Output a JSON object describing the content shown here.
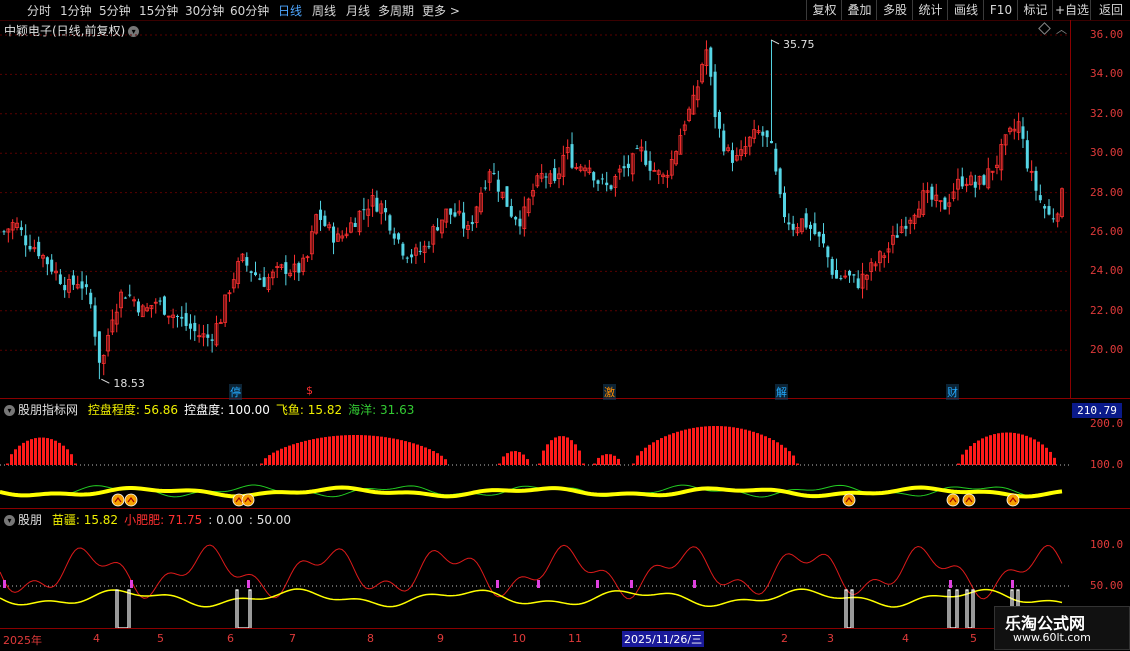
{
  "toolbar": {
    "left": [
      {
        "label": "分时",
        "active": false
      },
      {
        "label": "1分钟",
        "active": false
      },
      {
        "label": "5分钟",
        "active": false
      },
      {
        "label": "15分钟",
        "active": false
      },
      {
        "label": "30分钟",
        "active": false
      },
      {
        "label": "60分钟",
        "active": false
      },
      {
        "label": "日线",
        "active": true
      },
      {
        "label": "周线",
        "active": false
      },
      {
        "label": "月线",
        "active": false
      },
      {
        "label": "多周期",
        "active": false
      },
      {
        "label": "更多 >",
        "active": false
      }
    ],
    "right": [
      "复权",
      "叠加",
      "多股",
      "统计",
      "画线",
      "F10",
      "标记",
      "+自选",
      "返回"
    ]
  },
  "main_chart": {
    "title": "中颖电子(日线,前复权)",
    "high_label": "35.75",
    "low_label": "18.53",
    "events": [
      {
        "label": "停",
        "color": "#22aaff"
      },
      {
        "label": "$",
        "color": "#ff3030"
      },
      {
        "label": "激",
        "color": "#ff8c00"
      },
      {
        "label": "解",
        "color": "#22aaff"
      },
      {
        "label": "财",
        "color": "#22aaff"
      }
    ]
  },
  "indicator1": {
    "name": "股朋指标网",
    "items": [
      {
        "label": "控盘程度: 56.86",
        "color": "#f0f000"
      },
      {
        "label": "控盘度: 100.00",
        "color": "#ffffff"
      },
      {
        "label": "飞鱼: 15.82",
        "color": "#f0f000"
      },
      {
        "label": "海洋: 31.63",
        "color": "#33cc33"
      }
    ],
    "value_box": "210.79"
  },
  "indicator2": {
    "name": "股朋",
    "items": [
      {
        "label": "苗疆: 15.82",
        "color": "#f0f000"
      },
      {
        "label": "小肥肥: 71.75",
        "color": "#ff3030"
      },
      {
        "label": ": 0.00",
        "color": "#e0e0e0"
      },
      {
        "label": ": 50.00",
        "color": "#e0e0e0"
      }
    ]
  },
  "y_axis": {
    "main_ticks": [
      "36.00",
      "34.00",
      "32.00",
      "30.00",
      "28.00",
      "26.00",
      "24.00",
      "22.00",
      "20.00"
    ],
    "ind1_ticks": [
      "200.0",
      "100.0"
    ],
    "ind2_ticks": [
      "100.0",
      "50.00"
    ]
  },
  "x_axis": {
    "labels": [
      "2025年",
      "4",
      "5",
      "6",
      "7",
      "8",
      "9",
      "10",
      "11",
      "2",
      "3",
      "4",
      "5"
    ],
    "highlight": "2025/11/26/三"
  },
  "watermark": {
    "title": "乐淘公式网",
    "url": "www.60lt.com"
  },
  "chart_data": {
    "type": "candlestick",
    "ylim": [
      17.5,
      36.5
    ],
    "highest": 35.75,
    "lowest": 18.53,
    "close_path": [
      26.0,
      26.5,
      25.6,
      25.2,
      24.5,
      23.8,
      23.2,
      23.6,
      22.4,
      19.0,
      21.8,
      23.0,
      22.6,
      21.9,
      22.5,
      22.1,
      21.7,
      21.2,
      20.8,
      20.6,
      21.5,
      23.4,
      24.6,
      24.0,
      23.5,
      23.8,
      24.2,
      24.0,
      24.4,
      27.0,
      26.1,
      25.6,
      26.3,
      27.0,
      27.6,
      27.3,
      26.2,
      25.1,
      24.8,
      25.2,
      26.3,
      27.0,
      26.8,
      26.0,
      27.8,
      29.3,
      28.1,
      27.0,
      26.6,
      28.1,
      29.0,
      28.3,
      30.2,
      29.3,
      29.6,
      28.6,
      28.2,
      29.0,
      29.4,
      30.1,
      29.3,
      28.7,
      29.8,
      31.6,
      32.7,
      35.5,
      31.5,
      30.0,
      29.6,
      30.6,
      31.1,
      30.4,
      27.2,
      26.3,
      26.6,
      26.0,
      25.2,
      23.6,
      23.8,
      23.4,
      23.9,
      24.6,
      25.2,
      26.2,
      26.9,
      27.8,
      27.6,
      27.2,
      28.2,
      28.8,
      28.3,
      28.8,
      29.6,
      30.8,
      31.5,
      29.0,
      27.6,
      26.6,
      27.8
    ]
  }
}
